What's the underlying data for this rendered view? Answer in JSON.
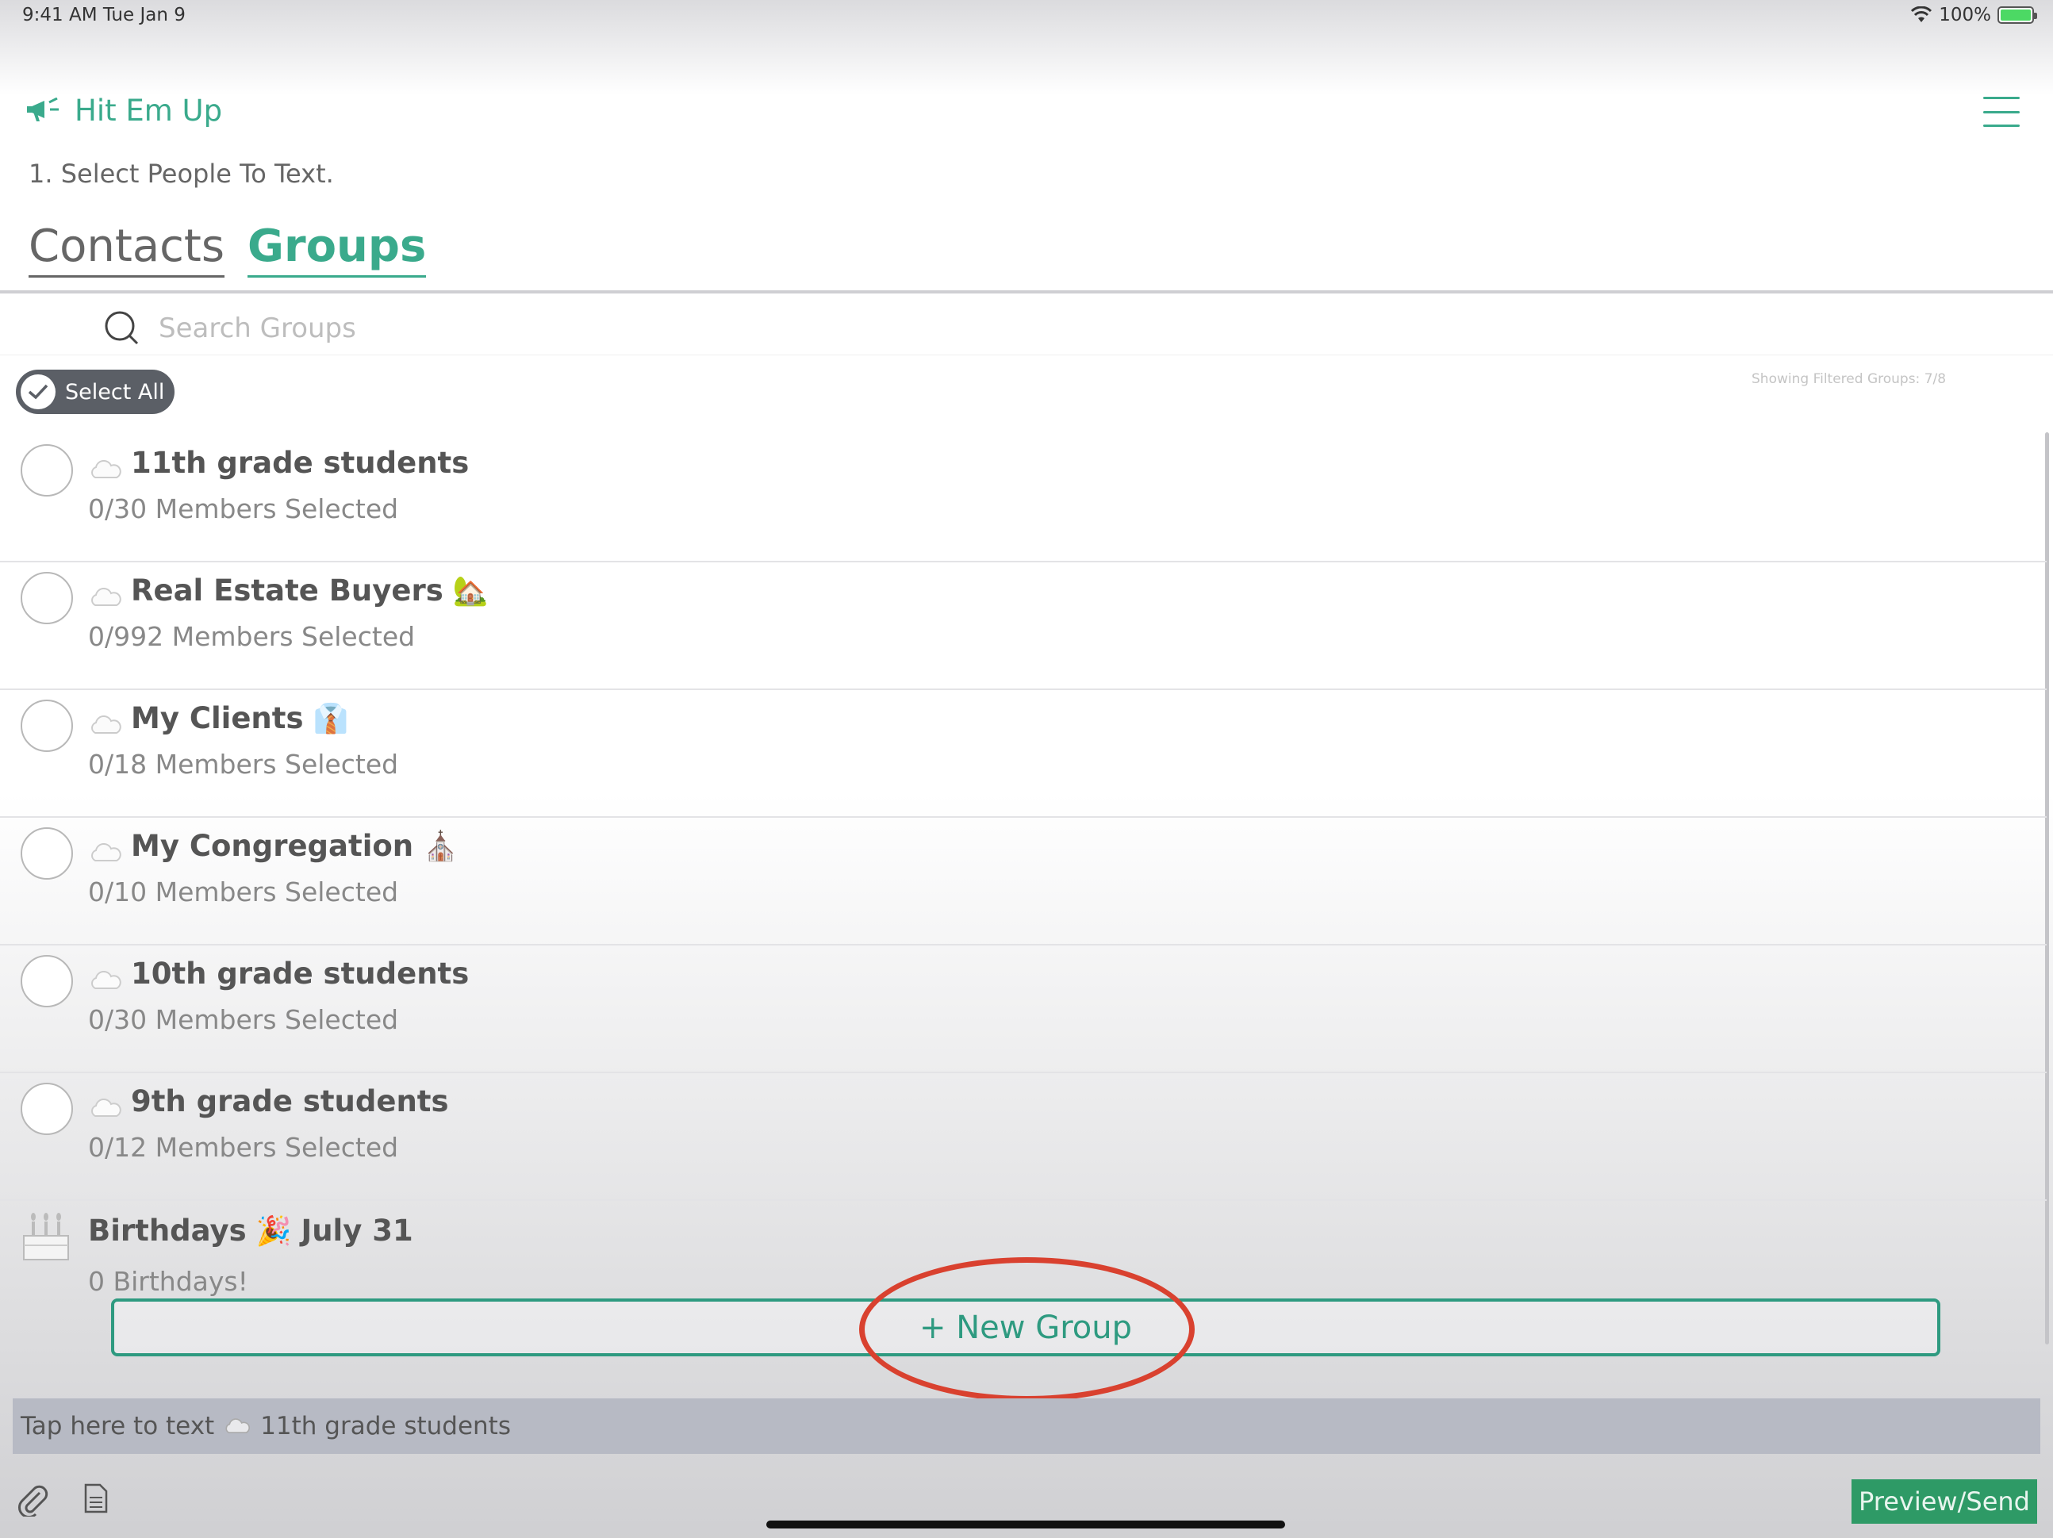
{
  "status_bar": {
    "time": "9:41 AM   Tue Jan 9",
    "battery": "100%"
  },
  "header": {
    "app_name": "Hit Em Up",
    "step": "1. Select People To Text."
  },
  "tabs": [
    {
      "label": "Contacts",
      "active": false
    },
    {
      "label": "Groups",
      "active": true
    }
  ],
  "search": {
    "placeholder": "Search Groups",
    "value": ""
  },
  "select_all": {
    "label": "Select All"
  },
  "filter_note": "Showing Filtered Groups: 7/8",
  "groups": [
    {
      "name": "11th grade students",
      "emoji": "",
      "subtitle": "0/30 Members Selected"
    },
    {
      "name": "Real Estate Buyers",
      "emoji": "🏡",
      "subtitle": "0/992 Members Selected"
    },
    {
      "name": "My Clients",
      "emoji": "👔",
      "subtitle": "0/18 Members Selected"
    },
    {
      "name": "My Congregation",
      "emoji": "⛪",
      "subtitle": "0/10 Members Selected"
    },
    {
      "name": "10th grade students",
      "emoji": "",
      "subtitle": "0/30 Members Selected"
    },
    {
      "name": "9th grade students",
      "emoji": "",
      "subtitle": "0/12 Members Selected"
    }
  ],
  "birthdays": {
    "label": "Birthdays",
    "emoji": "🎉",
    "date": "July 31",
    "subtitle": "0 Birthdays!"
  },
  "new_group": {
    "label": "+ New Group"
  },
  "tap_bar": {
    "prefix": "Tap here to text",
    "target": "11th grade students"
  },
  "preview_send": {
    "label": "Preview/Send"
  },
  "colors": {
    "accent": "#3aaa8c",
    "highlight_ring": "#d9412f",
    "send_button": "#2e9a66"
  }
}
